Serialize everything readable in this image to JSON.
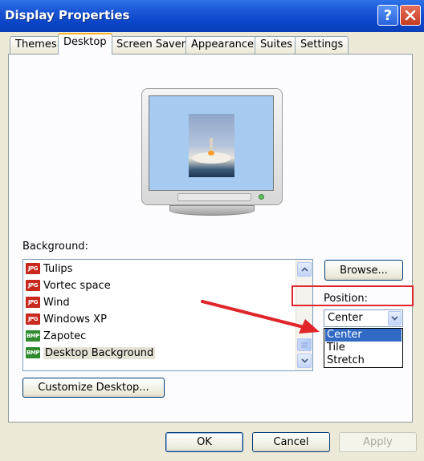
{
  "window": {
    "title": "Display Properties",
    "help_label": "?",
    "close_label": "✕"
  },
  "tabs": [
    {
      "label": "Themes"
    },
    {
      "label": "Desktop"
    },
    {
      "label": "Screen Saver"
    },
    {
      "label": "Appearance"
    },
    {
      "label": "Suites"
    },
    {
      "label": "Settings"
    }
  ],
  "active_tab": "Desktop",
  "desktop": {
    "background_label": "Background:",
    "background_items": [
      {
        "name": "Tulips",
        "type": "JPG"
      },
      {
        "name": "Vortec space",
        "type": "JPG"
      },
      {
        "name": "Wind",
        "type": "JPG"
      },
      {
        "name": "Windows XP",
        "type": "JPG"
      },
      {
        "name": "Zapotec",
        "type": "BMP"
      },
      {
        "name": "Desktop Background",
        "type": "BMP",
        "selected": true
      }
    ],
    "browse_label": "Browse...",
    "position_label": "Position:",
    "position_value": "Center",
    "position_options": [
      "Center",
      "Tile",
      "Stretch"
    ],
    "customize_label": "Customize Desktop..."
  },
  "footer": {
    "ok_label": "OK",
    "cancel_label": "Cancel",
    "apply_label": "Apply"
  },
  "colors": {
    "titlebar": "#0b45c8",
    "selection": "#316ac5",
    "annotation": "#e0262a"
  }
}
